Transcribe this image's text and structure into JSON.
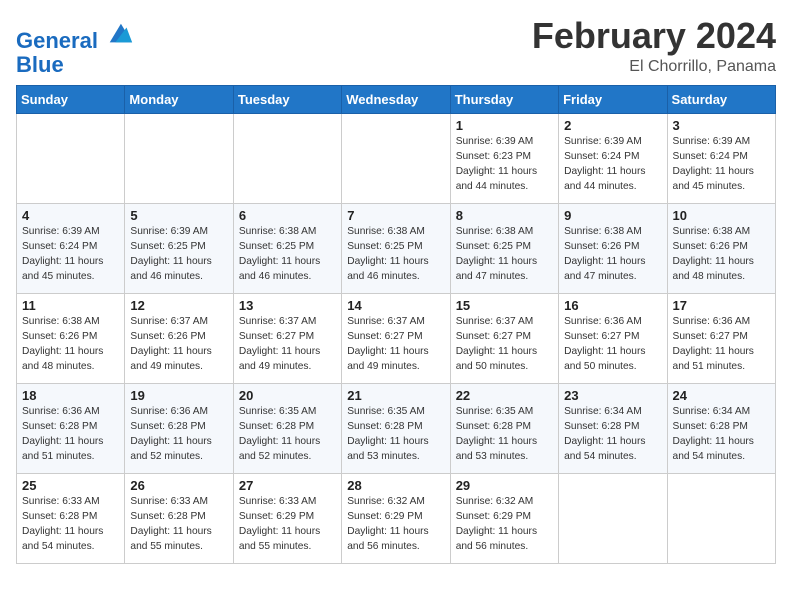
{
  "header": {
    "logo_line1": "General",
    "logo_line2": "Blue",
    "month_year": "February 2024",
    "location": "El Chorrillo, Panama"
  },
  "weekdays": [
    "Sunday",
    "Monday",
    "Tuesday",
    "Wednesday",
    "Thursday",
    "Friday",
    "Saturday"
  ],
  "weeks": [
    [
      {
        "day": "",
        "detail": ""
      },
      {
        "day": "",
        "detail": ""
      },
      {
        "day": "",
        "detail": ""
      },
      {
        "day": "",
        "detail": ""
      },
      {
        "day": "1",
        "detail": "Sunrise: 6:39 AM\nSunset: 6:23 PM\nDaylight: 11 hours\nand 44 minutes."
      },
      {
        "day": "2",
        "detail": "Sunrise: 6:39 AM\nSunset: 6:24 PM\nDaylight: 11 hours\nand 44 minutes."
      },
      {
        "day": "3",
        "detail": "Sunrise: 6:39 AM\nSunset: 6:24 PM\nDaylight: 11 hours\nand 45 minutes."
      }
    ],
    [
      {
        "day": "4",
        "detail": "Sunrise: 6:39 AM\nSunset: 6:24 PM\nDaylight: 11 hours\nand 45 minutes."
      },
      {
        "day": "5",
        "detail": "Sunrise: 6:39 AM\nSunset: 6:25 PM\nDaylight: 11 hours\nand 46 minutes."
      },
      {
        "day": "6",
        "detail": "Sunrise: 6:38 AM\nSunset: 6:25 PM\nDaylight: 11 hours\nand 46 minutes."
      },
      {
        "day": "7",
        "detail": "Sunrise: 6:38 AM\nSunset: 6:25 PM\nDaylight: 11 hours\nand 46 minutes."
      },
      {
        "day": "8",
        "detail": "Sunrise: 6:38 AM\nSunset: 6:25 PM\nDaylight: 11 hours\nand 47 minutes."
      },
      {
        "day": "9",
        "detail": "Sunrise: 6:38 AM\nSunset: 6:26 PM\nDaylight: 11 hours\nand 47 minutes."
      },
      {
        "day": "10",
        "detail": "Sunrise: 6:38 AM\nSunset: 6:26 PM\nDaylight: 11 hours\nand 48 minutes."
      }
    ],
    [
      {
        "day": "11",
        "detail": "Sunrise: 6:38 AM\nSunset: 6:26 PM\nDaylight: 11 hours\nand 48 minutes."
      },
      {
        "day": "12",
        "detail": "Sunrise: 6:37 AM\nSunset: 6:26 PM\nDaylight: 11 hours\nand 49 minutes."
      },
      {
        "day": "13",
        "detail": "Sunrise: 6:37 AM\nSunset: 6:27 PM\nDaylight: 11 hours\nand 49 minutes."
      },
      {
        "day": "14",
        "detail": "Sunrise: 6:37 AM\nSunset: 6:27 PM\nDaylight: 11 hours\nand 49 minutes."
      },
      {
        "day": "15",
        "detail": "Sunrise: 6:37 AM\nSunset: 6:27 PM\nDaylight: 11 hours\nand 50 minutes."
      },
      {
        "day": "16",
        "detail": "Sunrise: 6:36 AM\nSunset: 6:27 PM\nDaylight: 11 hours\nand 50 minutes."
      },
      {
        "day": "17",
        "detail": "Sunrise: 6:36 AM\nSunset: 6:27 PM\nDaylight: 11 hours\nand 51 minutes."
      }
    ],
    [
      {
        "day": "18",
        "detail": "Sunrise: 6:36 AM\nSunset: 6:28 PM\nDaylight: 11 hours\nand 51 minutes."
      },
      {
        "day": "19",
        "detail": "Sunrise: 6:36 AM\nSunset: 6:28 PM\nDaylight: 11 hours\nand 52 minutes."
      },
      {
        "day": "20",
        "detail": "Sunrise: 6:35 AM\nSunset: 6:28 PM\nDaylight: 11 hours\nand 52 minutes."
      },
      {
        "day": "21",
        "detail": "Sunrise: 6:35 AM\nSunset: 6:28 PM\nDaylight: 11 hours\nand 53 minutes."
      },
      {
        "day": "22",
        "detail": "Sunrise: 6:35 AM\nSunset: 6:28 PM\nDaylight: 11 hours\nand 53 minutes."
      },
      {
        "day": "23",
        "detail": "Sunrise: 6:34 AM\nSunset: 6:28 PM\nDaylight: 11 hours\nand 54 minutes."
      },
      {
        "day": "24",
        "detail": "Sunrise: 6:34 AM\nSunset: 6:28 PM\nDaylight: 11 hours\nand 54 minutes."
      }
    ],
    [
      {
        "day": "25",
        "detail": "Sunrise: 6:33 AM\nSunset: 6:28 PM\nDaylight: 11 hours\nand 54 minutes."
      },
      {
        "day": "26",
        "detail": "Sunrise: 6:33 AM\nSunset: 6:28 PM\nDaylight: 11 hours\nand 55 minutes."
      },
      {
        "day": "27",
        "detail": "Sunrise: 6:33 AM\nSunset: 6:29 PM\nDaylight: 11 hours\nand 55 minutes."
      },
      {
        "day": "28",
        "detail": "Sunrise: 6:32 AM\nSunset: 6:29 PM\nDaylight: 11 hours\nand 56 minutes."
      },
      {
        "day": "29",
        "detail": "Sunrise: 6:32 AM\nSunset: 6:29 PM\nDaylight: 11 hours\nand 56 minutes."
      },
      {
        "day": "",
        "detail": ""
      },
      {
        "day": "",
        "detail": ""
      }
    ]
  ]
}
